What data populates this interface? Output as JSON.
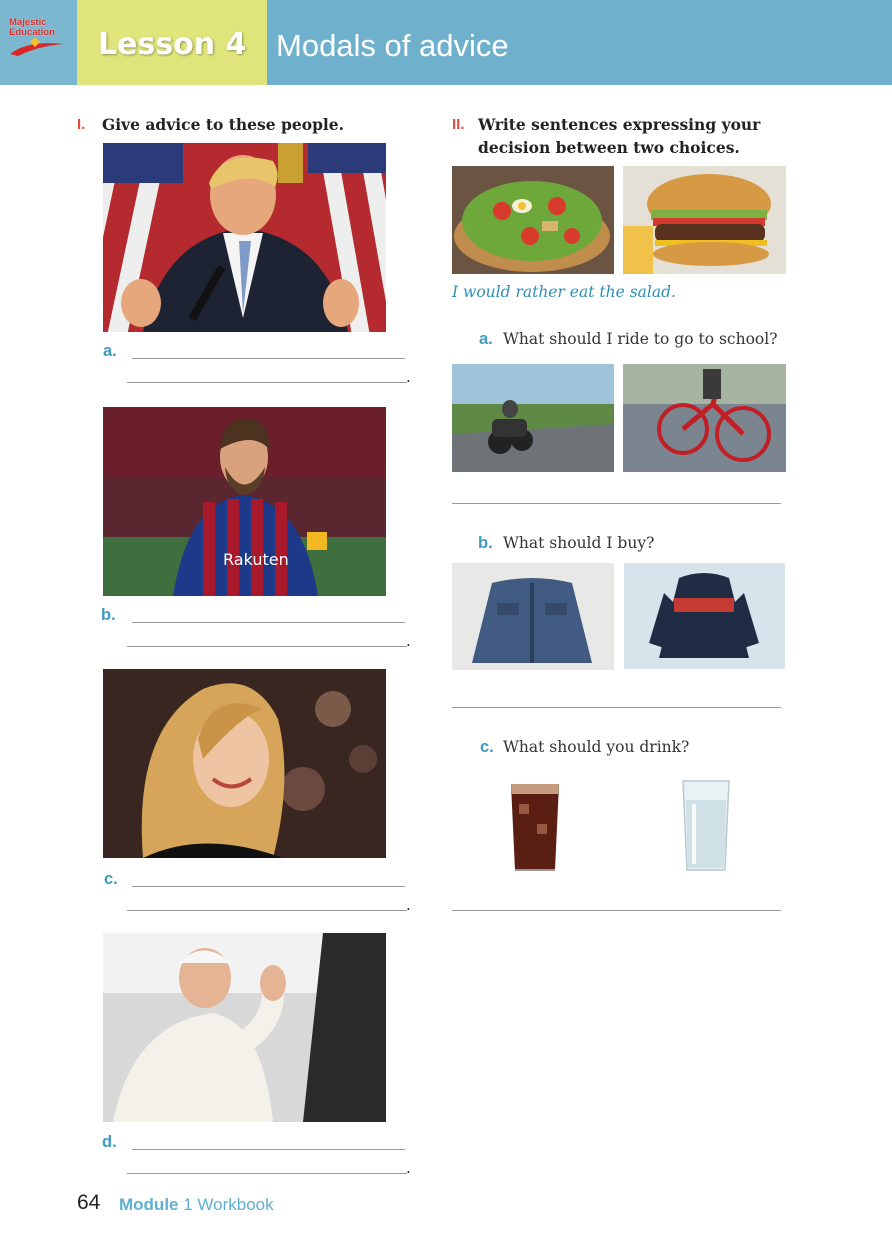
{
  "header": {
    "logo_text_line1": "Majestic",
    "logo_text_line2": "Education",
    "lesson_label": "Lesson 4",
    "lesson_title": "Modals of advice"
  },
  "section1": {
    "number": "I.",
    "instruction": "Give advice to these people.",
    "items": [
      {
        "letter": "a."
      },
      {
        "letter": "b."
      },
      {
        "letter": "c."
      },
      {
        "letter": "d."
      }
    ]
  },
  "section2": {
    "number": "II.",
    "instruction_line1": "Write sentences expressing your",
    "instruction_line2": "decision between two choices.",
    "example": "I would rather eat the salad.",
    "items": [
      {
        "letter": "a.",
        "question": "What should I ride to go to school?"
      },
      {
        "letter": "b.",
        "question": "What should I buy?"
      },
      {
        "letter": "c.",
        "question": "What should you drink?"
      }
    ]
  },
  "footer": {
    "page_number": "64",
    "module_label": "Module",
    "module_rest": "1 Workbook"
  },
  "colors": {
    "header_blue": "#6fb1cc",
    "lesson_yellow": "#dfe57a",
    "roman_red": "#e84a3b",
    "letter_blue": "#3e9cc3"
  }
}
